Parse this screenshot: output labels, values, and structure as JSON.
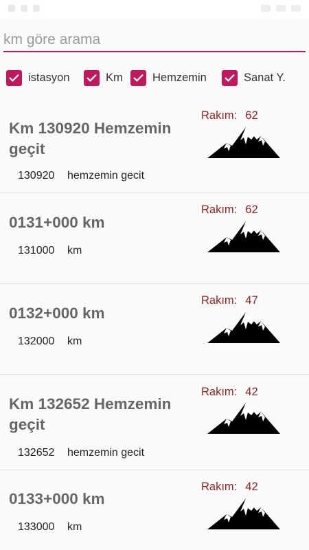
{
  "search": {
    "placeholder": "km göre arama",
    "value": ""
  },
  "filters": [
    {
      "label": "istasyon",
      "checked": true
    },
    {
      "label": "Km",
      "checked": true
    },
    {
      "label": "Hemzemin",
      "checked": true
    },
    {
      "label": "Sanat Y.",
      "checked": true
    }
  ],
  "rakim_label": "Rakım:",
  "rows": [
    {
      "title": "Km 130920 Hemzemin geçit",
      "km": "130920",
      "type": "hemzemin gecit",
      "rakim": "62"
    },
    {
      "title": "0131+000 km",
      "km": "131000",
      "type": "km",
      "rakim": "62"
    },
    {
      "title": "0132+000 km",
      "km": "132000",
      "type": "km",
      "rakim": "47"
    },
    {
      "title": "Km 132652 Hemzemin geçit",
      "km": "132652",
      "type": "hemzemin gecit",
      "rakim": "42"
    },
    {
      "title": "0133+000 km",
      "km": "133000",
      "type": "km",
      "rakim": "42"
    }
  ],
  "icons": {
    "checkbox": "checkmark-icon",
    "elevation": "mountain-icon"
  },
  "colors": {
    "accent": "#c2185b",
    "rakim": "#9b1c1c",
    "title": "#666666"
  }
}
